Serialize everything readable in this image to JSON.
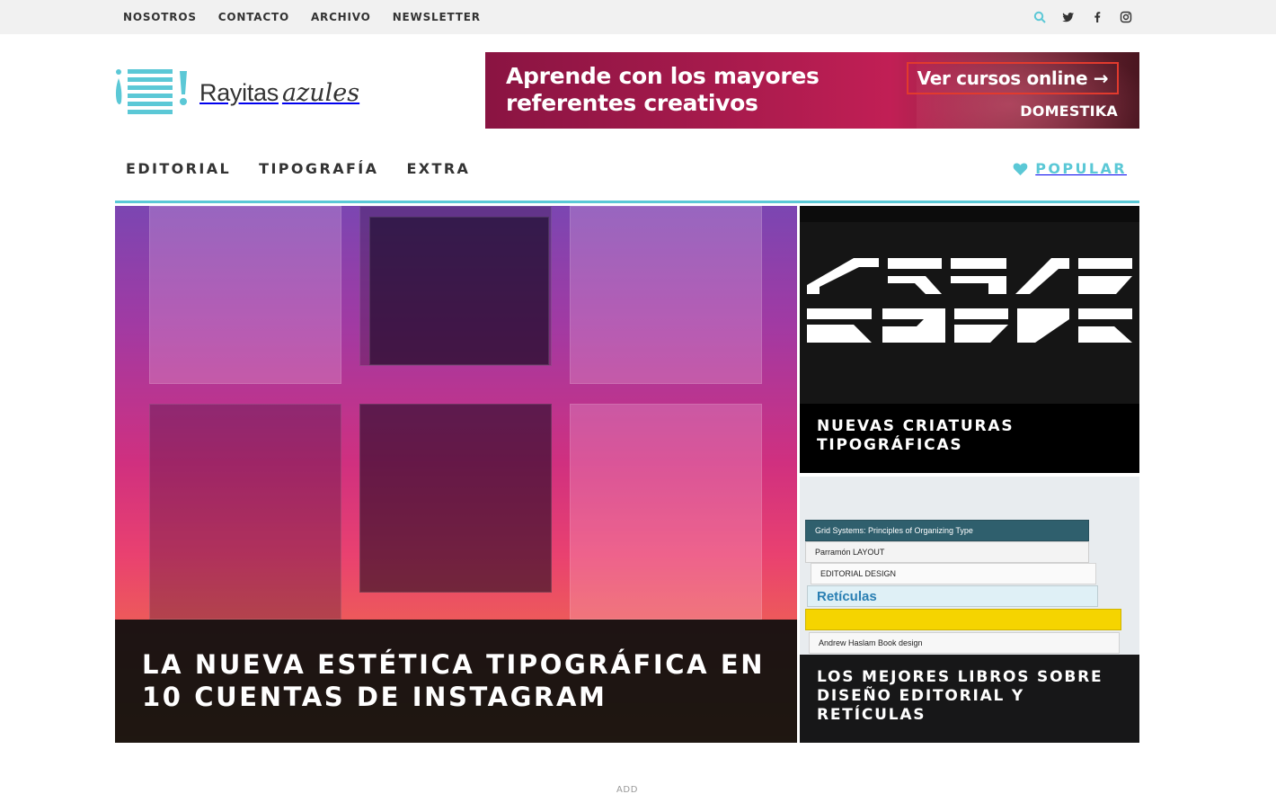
{
  "topbar": {
    "nav": [
      "NOSOTROS",
      "CONTACTO",
      "ARCHIVO",
      "NEWSLETTER"
    ],
    "social_icons": [
      "search-icon",
      "twitter-icon",
      "facebook-icon",
      "instagram-icon"
    ],
    "accent": "#5bc8d6"
  },
  "logo": {
    "word1": "Rayitas",
    "word2": "azules",
    "color": "#5bc8d6"
  },
  "banner": {
    "headline_line1": "Aprende con los mayores",
    "headline_line2": "referentes creativos",
    "cta": "Ver cursos online →",
    "brand": "DOMESTIKA",
    "cta_border": "#e23a2d"
  },
  "mainnav": {
    "categories": [
      "EDITORIAL",
      "TIPOGRAFÍA",
      "EXTRA"
    ],
    "popular": "POPULAR"
  },
  "features": {
    "hero_title": "LA NUEVA ESTÉTICA TIPOGRÁFICA EN 10 CUENTAS DE INSTAGRAM",
    "side1_title": "NUEVAS CRIATURAS TIPOGRÁFICAS",
    "side2_title": "LOS MEJORES LIBROS SOBRE DISEÑO EDITORIAL Y RETÍCULAS"
  },
  "books": [
    "Grid Systems: Principles of Organizing Type",
    "Parramón   LAYOUT",
    "EDITORIAL DESIGN",
    "Retículas",
    "",
    "Andrew Haslam   Book design"
  ],
  "ad_label": "ADD"
}
